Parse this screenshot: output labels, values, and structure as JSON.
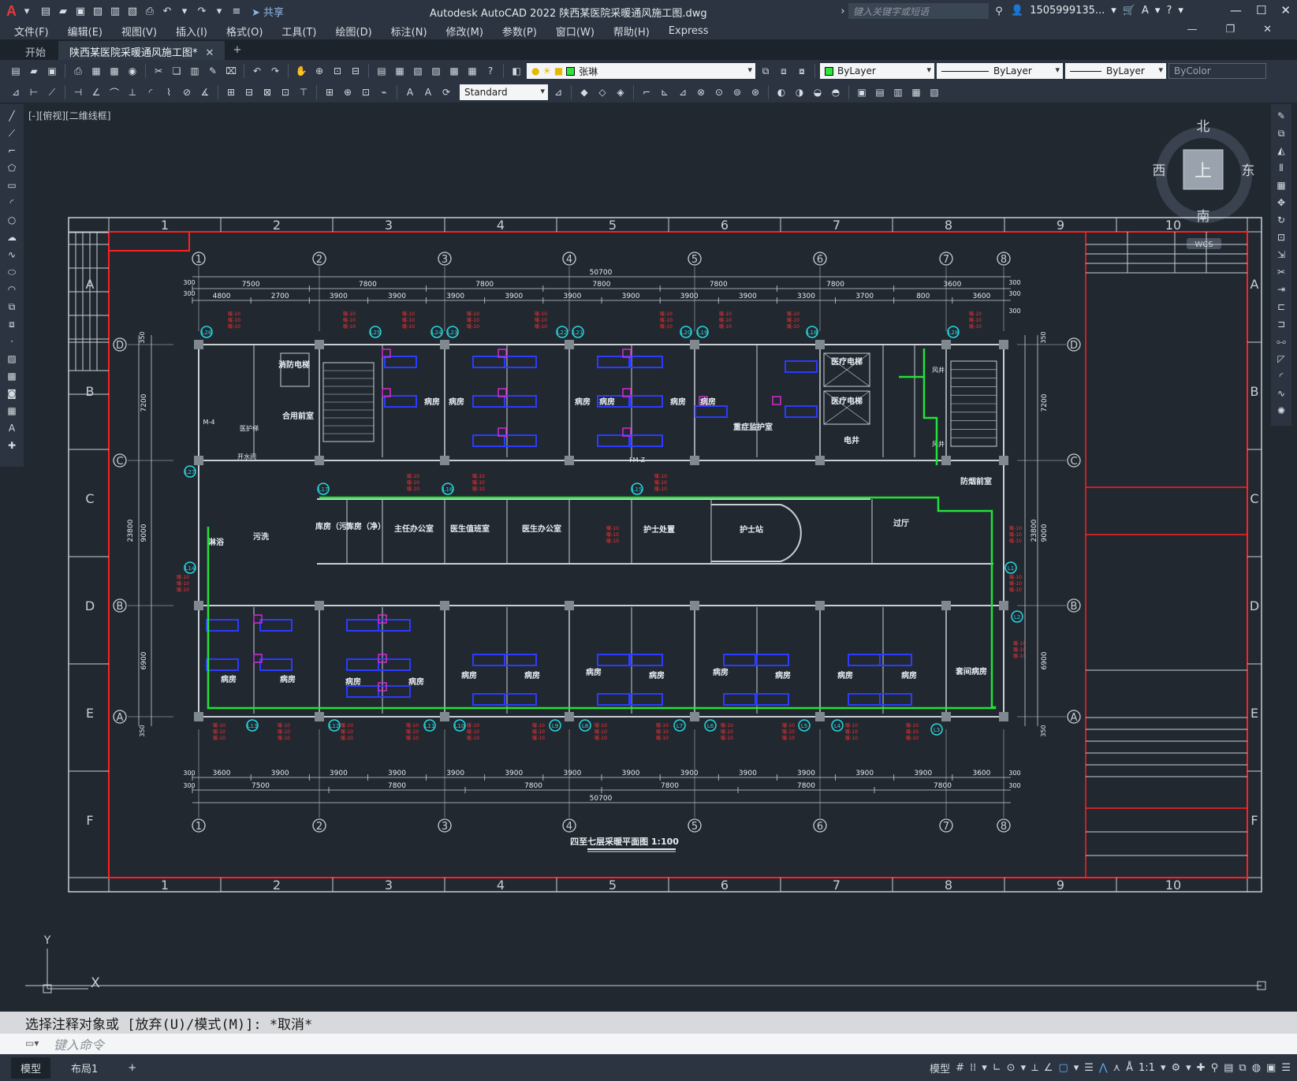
{
  "app": {
    "logo": "A",
    "title": "Autodesk AutoCAD 2022    陕西某医院采暖通风施工图.dwg",
    "share_label": "共享",
    "search_placeholder": "键入关键字或短语",
    "user_name": "1505999135...",
    "window_controls": [
      "—",
      "☐",
      "✕"
    ]
  },
  "menu": [
    "文件(F)",
    "编辑(E)",
    "视图(V)",
    "插入(I)",
    "格式(O)",
    "工具(T)",
    "绘图(D)",
    "标注(N)",
    "修改(M)",
    "参数(P)",
    "窗口(W)",
    "帮助(H)",
    "Express"
  ],
  "tabs": {
    "start": "开始",
    "drawing": "陕西某医院采暖通风施工图*",
    "close": "✕",
    "add": "+"
  },
  "toolbar": {
    "layer_name": "张琳",
    "color": "ByLayer",
    "linetype": "ByLayer",
    "lineweight": "ByLayer",
    "plotstyle": "ByColor",
    "text_style": "Standard"
  },
  "viewport": {
    "label": "[-][俯视][二维线框]",
    "compass": {
      "north": "北",
      "south": "南",
      "east": "东",
      "west": "西",
      "top": "上",
      "wcs": "WCS"
    },
    "ucs_x": "X",
    "ucs_y": "Y"
  },
  "drawing": {
    "frame_columns": [
      "1",
      "2",
      "3",
      "4",
      "5",
      "6",
      "7",
      "8",
      "9",
      "10"
    ],
    "frame_rows": [
      "A",
      "B",
      "C",
      "D",
      "E",
      "F"
    ],
    "axis_numbers": [
      "1",
      "2",
      "3",
      "4",
      "5",
      "6",
      "7",
      "8"
    ],
    "axis_letters": [
      "D",
      "C",
      "B",
      "A"
    ],
    "total_width": "50700",
    "total_height": "23800",
    "top_dims_1": [
      "7500",
      "7800",
      "7800",
      "7800",
      "7800",
      "7800",
      "3600"
    ],
    "top_dims_2": [
      "4800",
      "2700",
      "3900",
      "3900",
      "3900",
      "3900",
      "3900",
      "3900",
      "3900",
      "3900",
      "3300",
      "3700",
      "800",
      "3600"
    ],
    "bottom_dims_1": [
      "3600",
      "3900",
      "3900",
      "3900",
      "3900",
      "3900",
      "3900",
      "3900",
      "3900",
      "3900",
      "3900",
      "3900",
      "3900",
      "3600"
    ],
    "bottom_dims_2": [
      "7500",
      "7800",
      "7800",
      "7800",
      "7800",
      "7800"
    ],
    "side_dims": [
      "7200",
      "9000",
      "6900"
    ],
    "edge_dims": [
      "300",
      "350"
    ],
    "top_rooms": [
      "合用前室",
      "消防电梯",
      "病房",
      "病房",
      "病房",
      "病房",
      "病房",
      "病房",
      "重症监护室",
      "医疗电梯",
      "医疗电梯",
      "电井",
      "防烟前室"
    ],
    "mid_rooms": [
      "淋浴",
      "污洗",
      "库房（污）",
      "库房（净）",
      "主任办公室",
      "医生值班室",
      "医生办公室",
      "护士处置",
      "护士站",
      "过厅"
    ],
    "bottom_rooms": [
      "病房",
      "病房",
      "病房",
      "病房",
      "病房",
      "病房",
      "病房",
      "病房",
      "病房",
      "病房",
      "病房",
      "病房",
      "套间病房"
    ],
    "misc_labels": [
      "医护梯",
      "开水间",
      "FM-Z",
      "风井",
      "风井",
      "M-4"
    ],
    "plan_title": "四至七层采暖平面图 1:100",
    "riser_tags_top": [
      "L26",
      "L25",
      "L24",
      "L23",
      "L22",
      "L21",
      "L20",
      "L19",
      "L18",
      "L28"
    ],
    "riser_tags_mid": [
      "L27",
      "L17",
      "L16",
      "L15",
      "L14",
      "L1",
      "L2"
    ],
    "riser_tags_bottom": [
      "L13",
      "L12",
      "L11",
      "L10",
      "L9",
      "L8",
      "L7",
      "L6",
      "L5",
      "L4",
      "L3"
    ],
    "radiator_note": "暖-10"
  },
  "command": {
    "history": "选择注释对象或 [放弃(U)/模式(M)]: *取消*",
    "prompt_placeholder": "键入命令"
  },
  "statusbar": {
    "layout_tabs": [
      "模型",
      "布局1"
    ],
    "add_layout": "+",
    "model_label": "模型",
    "scale": "1:1"
  }
}
